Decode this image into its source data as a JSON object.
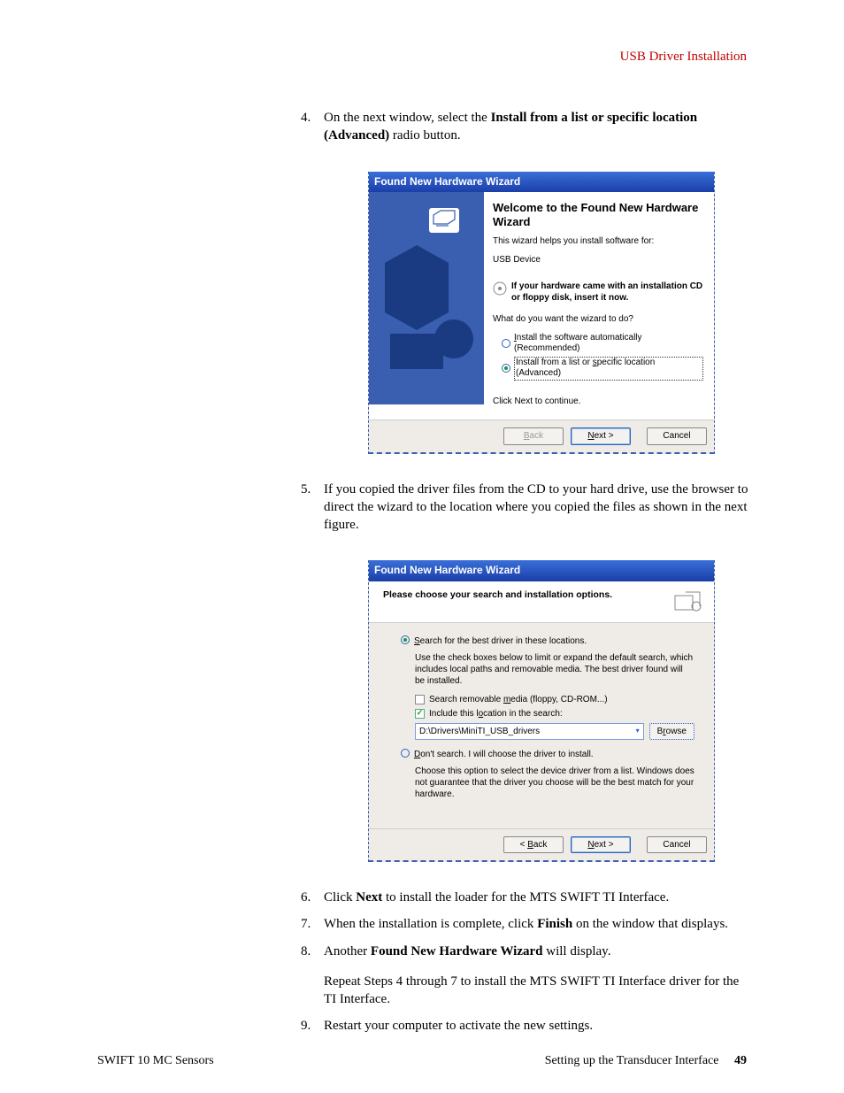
{
  "header": {
    "title": "USB Driver Installation"
  },
  "steps": {
    "s4_a": "On the next window, select the ",
    "s4_b1": "Install from a list or specific location ",
    "s4_b2": "(Advanced)",
    "s4_c": " radio button.",
    "s5": "If you copied the driver files from the CD to your hard drive, use the browser to direct the wizard to the location where you copied the files as shown in the next figure.",
    "s6_a": "Click ",
    "s6_b": "Next",
    "s6_c": " to install the loader for the MTS SWIFT TI Interface.",
    "s7_a": "When the installation is complete, click ",
    "s7_b": "Finish",
    "s7_c": " on the window that displays.",
    "s8_a": "Another ",
    "s8_b": "Found New Hardware Wizard",
    "s8_c": " will display.",
    "s8_d": "Repeat Steps 4 through 7 to install the MTS SWIFT TI Interface driver for the TI Interface.",
    "s9": "Restart your computer to activate the new settings."
  },
  "wiz1": {
    "titlebar": "Found New Hardware Wizard",
    "heading": "Welcome to the Found New Hardware Wizard",
    "helps": "This wizard helps you install software for:",
    "device": "USB Device",
    "cd": "If your hardware came with an installation CD or floppy disk, insert it now.",
    "what": "What do you want the wizard to do?",
    "opt1": "Install the software automatically (Recommended)",
    "opt2": "Install from a list or specific location (Advanced)",
    "clicknext": "Click Next to continue.",
    "back": "< Back",
    "next": "Next >",
    "cancel": "Cancel"
  },
  "wiz2": {
    "titlebar": "Found New Hardware Wizard",
    "heading": "Please choose your search and installation options.",
    "opt1": "Search for the best driver in these locations.",
    "opt1desc": "Use the check boxes below to limit or expand the default search, which includes local paths and removable media. The best driver found will be installed.",
    "chk1": "Search removable media (floppy, CD-ROM...)",
    "chk2": "Include this location in the search:",
    "path": "D:\\Drivers\\MiniTI_USB_drivers",
    "browse": "Browse",
    "opt2": "Don't search. I will choose the driver to install.",
    "opt2desc": "Choose this option to select the device driver from a list. Windows does not guarantee that the driver you choose will be the best match for your hardware.",
    "back": "< Back",
    "next": "Next >",
    "cancel": "Cancel"
  },
  "footer": {
    "left": "SWIFT 10 MC Sensors",
    "right": "Setting up the Transducer Interface",
    "page": "49"
  }
}
